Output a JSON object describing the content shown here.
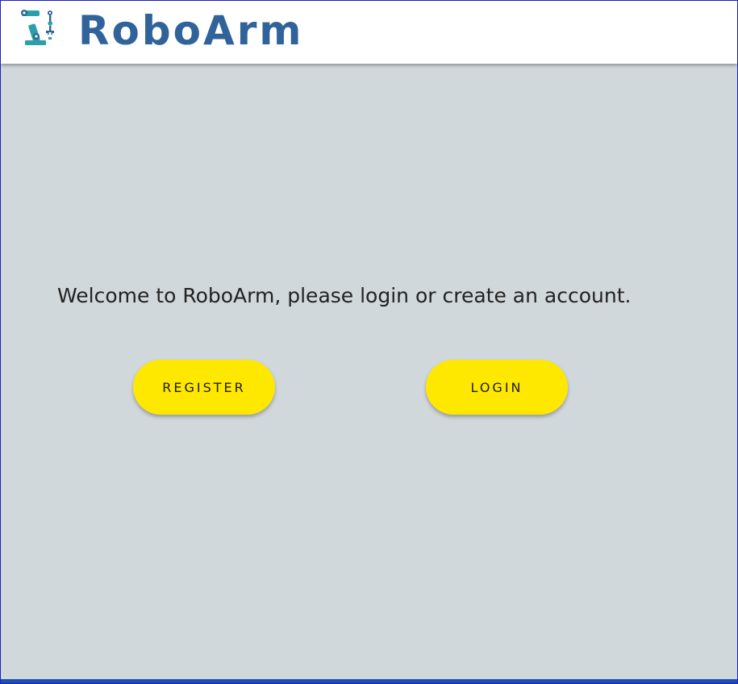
{
  "header": {
    "brand": "RoboArm",
    "logo_icon": "robot-arm-icon"
  },
  "main": {
    "welcome_text": "Welcome to RoboArm, please login or create an account.",
    "register_label": "REGISTER",
    "login_label": "LOGIN"
  },
  "colors": {
    "brand": "#2f6399",
    "background": "#d1d8db",
    "button": "#ffe800",
    "footer_bar": "#1c4fb0"
  }
}
